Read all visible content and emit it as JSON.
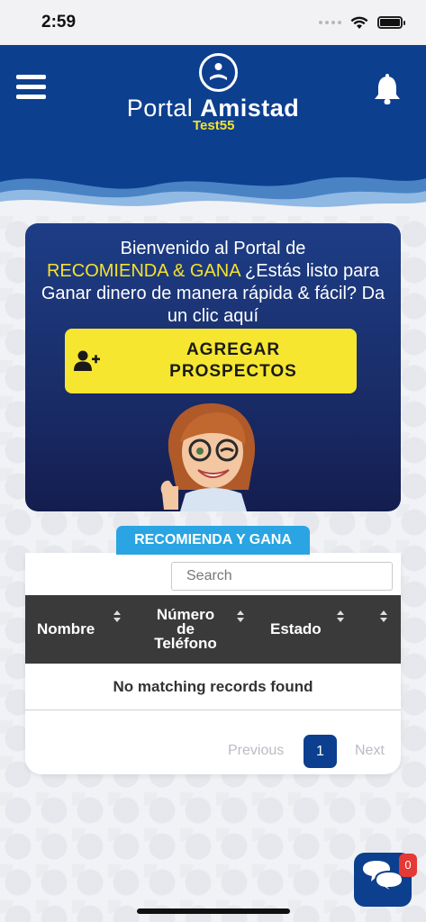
{
  "status_bar": {
    "time": "2:59"
  },
  "header": {
    "brand_light": "Portal",
    "brand_bold": "Amistad",
    "brand_sub": "Test55"
  },
  "promo": {
    "text_before": "Bienvenido al Portal de",
    "text_highlight": "RECOMIENDA & GANA",
    "text_after": "¿Estás listo para Ganar dinero de manera rápida & fácil? Da un clic aquí",
    "button_label": "AGREGAR\nPROSPECTOS"
  },
  "section": {
    "tab_label": "RECOMIENDA Y GANA",
    "search_placeholder": "Search",
    "columns": [
      "Nombre",
      "Número\nde\nTeléfono",
      "Estado",
      ""
    ],
    "empty_message": "No matching records found",
    "pagination": {
      "previous": "Previous",
      "current_page": "1",
      "next": "Next"
    }
  },
  "chat": {
    "badge_count": "0"
  },
  "colors": {
    "brand_blue": "#0d3f8f",
    "accent_yellow": "#f6e630",
    "tab_blue": "#2aa4e2",
    "table_header": "#3a3a3a",
    "badge_red": "#e53935"
  },
  "icons": [
    "menu-icon",
    "logo-icon",
    "bell-icon",
    "user-plus-icon",
    "sort-icon",
    "chat-icon",
    "wifi-icon",
    "battery-icon"
  ]
}
